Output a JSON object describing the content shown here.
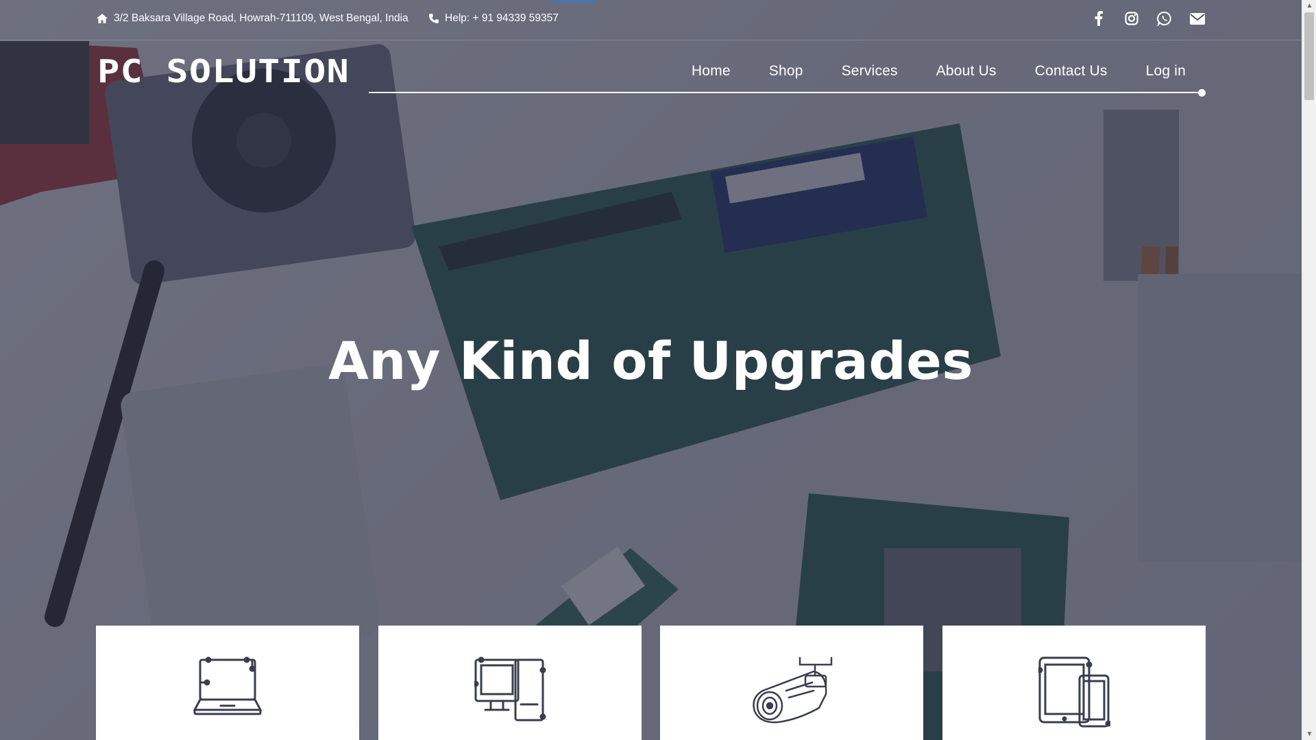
{
  "topbar": {
    "address": "3/2 Baksara Village Road, Howrah-711109, West Bengal, India",
    "phone": "Help: + 91 94339 59357",
    "icons": [
      "home-icon",
      "phone-icon",
      "facebook-icon",
      "instagram-icon",
      "whatsapp-icon",
      "envelope-icon"
    ]
  },
  "brand": {
    "logo_text": "PC SOLUTION"
  },
  "nav": {
    "items": [
      {
        "label": "Home"
      },
      {
        "label": "Shop"
      },
      {
        "label": "Services"
      },
      {
        "label": "About Us"
      },
      {
        "label": "Contact Us"
      },
      {
        "label": "Log in"
      }
    ]
  },
  "hero": {
    "headline": "Any Kind of Upgrades"
  },
  "cards": [
    {
      "icon": "laptop-icon"
    },
    {
      "icon": "desktop-devices-icon"
    },
    {
      "icon": "cctv-camera-icon"
    },
    {
      "icon": "tablet-phone-icon"
    }
  ],
  "colors": {
    "overlay": "#2c2e46",
    "accent": "#2d7bd2",
    "text": "#ffffff",
    "icon_stroke": "#3a3d4e"
  }
}
